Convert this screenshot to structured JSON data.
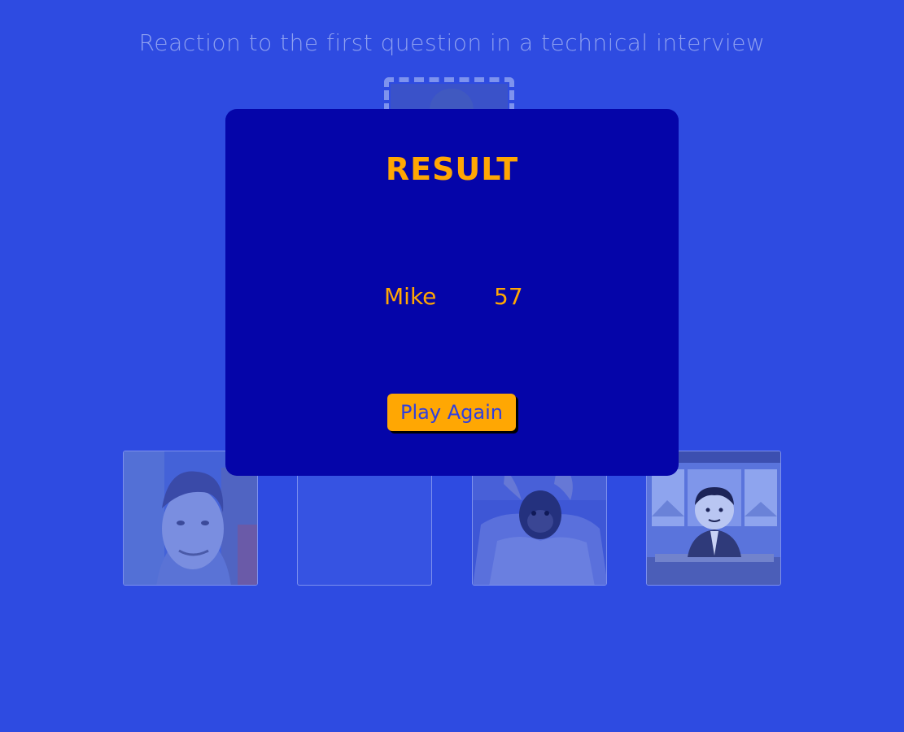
{
  "question": {
    "text": "Reaction to the first question in a technical interview"
  },
  "drop_zone": {
    "icon": "dashed-drop-target"
  },
  "cards": [
    {
      "image": "smiling-young-man-photo"
    },
    {
      "image": "empty-card"
    },
    {
      "image": "monkey-getting-haircut-photo"
    },
    {
      "image": "cartoon-news-anchor"
    }
  ],
  "result": {
    "title": "RESULT",
    "player": {
      "name": "Mike",
      "score": "57"
    },
    "play_again_label": "Play Again"
  },
  "colors": {
    "background": "#2e4be1",
    "overlay": "#0505a9",
    "accent": "#ffa703",
    "muted_text": "#8ea0f0"
  }
}
